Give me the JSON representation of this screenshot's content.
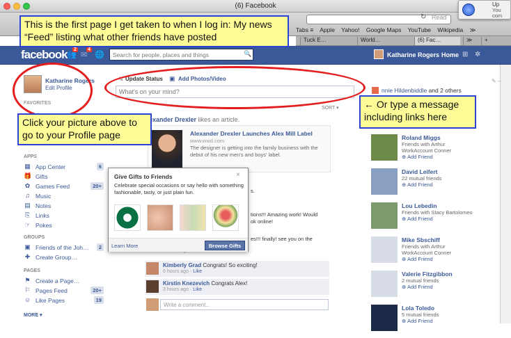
{
  "window": {
    "title": "(6) Facebook",
    "reader_label": "Read",
    "reload_glyph": "↻"
  },
  "bookmarks": [
    "Tabs ≡",
    "Apple",
    "Yahoo!",
    "Google Maps",
    "YouTube",
    "Wikipedia",
    "≫"
  ],
  "tabs": [
    "Tuck E…",
    "World…",
    "(6) Fac…",
    "≫",
    "+"
  ],
  "notification": {
    "title": "Up",
    "body1": "You",
    "body2": "com"
  },
  "fb": {
    "logo": "facebook",
    "friend_requests": "2",
    "messages": "4",
    "search_placeholder": "Search for people, places and things",
    "user_name": "Katharine Rogers",
    "home_label": "Home"
  },
  "profile": {
    "name": "Katharine Rogers",
    "edit": "Edit Profile",
    "favorites_hdr": "FAVORITES"
  },
  "apps_hdr": "APPS",
  "apps": [
    {
      "icon": "app-center-icon",
      "glyph": "▦",
      "label": "App Center",
      "count": "6"
    },
    {
      "icon": "gift-icon",
      "glyph": "🎁",
      "label": "Gifts",
      "count": ""
    },
    {
      "icon": "games-icon",
      "glyph": "✿",
      "label": "Games Feed",
      "count": "20+"
    },
    {
      "icon": "music-icon",
      "glyph": "♫",
      "label": "Music",
      "count": ""
    },
    {
      "icon": "notes-icon",
      "glyph": "▤",
      "label": "Notes",
      "count": ""
    },
    {
      "icon": "links-icon",
      "glyph": "⎘",
      "label": "Links",
      "count": ""
    },
    {
      "icon": "pokes-icon",
      "glyph": "☞",
      "label": "Pokes",
      "count": ""
    }
  ],
  "groups_hdr": "GROUPS",
  "groups": [
    {
      "icon": "group-icon",
      "glyph": "▣",
      "label": "Friends of the Joh…",
      "count": "2"
    },
    {
      "icon": "create-group-icon",
      "glyph": "✚",
      "label": "Create Group…",
      "count": ""
    }
  ],
  "pages_hdr": "PAGES",
  "pages": [
    {
      "icon": "create-page-icon",
      "glyph": "⚑",
      "label": "Create a Page…",
      "count": ""
    },
    {
      "icon": "pages-feed-icon",
      "glyph": "⚐",
      "label": "Pages Feed",
      "count": "20+"
    },
    {
      "icon": "like-pages-icon",
      "glyph": "☺",
      "label": "Like Pages",
      "count": "19"
    }
  ],
  "more": "MORE ▾",
  "composer": {
    "update_status": "Update Status",
    "add_photos": "Add Photos/Video",
    "placeholder": "What's on your mind?",
    "sort": "SORT ▾"
  },
  "story": {
    "actor": "exander Drexler",
    "verb": " likes an article.",
    "link_title": "Alexander Drexler Launches Alex Mill Label",
    "link_url": "www.wwd.com",
    "link_desc": "The designer is getting into the family business with the debut of his new men's and boys' label."
  },
  "fragments": [
    "s.",
    "tions!!! Amazing work! Would",
    "ok online!",
    "es!!! finally! see you on the"
  ],
  "gifts": {
    "title": "Give Gifts to Friends",
    "close": "×",
    "desc": "Celebrate special occasions or say hello with something fashionable, tasty, or just plain fun.",
    "learn_more": "Learn More",
    "browse": "Browse Gifts"
  },
  "comments": [
    {
      "name": "",
      "text": "",
      "meta": "6 hours ago · ",
      "like": "Like"
    },
    {
      "name": "Kimberly Grad",
      "text": " Congrats! So exciting!",
      "meta": "6 hours ago · ",
      "like": "Like"
    },
    {
      "name": "Kirstin Knezevich",
      "text": " Congrats Alex!",
      "meta": "3 hours ago · ",
      "like": "Like"
    }
  ],
  "write_comment": "Write a comment...",
  "birthday": {
    "name": "nnie Hildenbiddle",
    "rest": " and 2 others"
  },
  "edit_pencil": "✎ –",
  "pymk": [
    {
      "name": "Roland Miggs",
      "sub1": "Friends with Arthur",
      "sub2": "WorkAccount Conner",
      "add": "Add Friend",
      "color": "#6e8a4b"
    },
    {
      "name": "David Leifert",
      "sub1": "22 mutual friends",
      "sub2": "",
      "add": "Add Friend",
      "color": "#8aa0c0"
    },
    {
      "name": "Lou Lebedin",
      "sub1": "Friends with Stacy Bartolomeo",
      "sub2": "",
      "add": "Add Friend",
      "color": "#7d9b6a"
    },
    {
      "name": "Mike Sbschiff",
      "sub1": "Friends with Arthur",
      "sub2": "WorkAccount Conner",
      "add": "Add Friend",
      "color": "#d8dce6"
    },
    {
      "name": "Valerie Fitzgibbon",
      "sub1": "2 mutual friends",
      "sub2": "",
      "add": "Add Friend",
      "color": "#d8dce6"
    },
    {
      "name": "Lola Toledo",
      "sub1": "5 mutual friends",
      "sub2": "",
      "add": "Add Friend",
      "color": "#1c2a48"
    }
  ],
  "annotations": {
    "top": "This is the first page I get taken to when I log in: My news “Feed” listing what other friends have posted",
    "left": "Click your picture above to go to your Profile page",
    "right": "← Or type a message including links here"
  }
}
